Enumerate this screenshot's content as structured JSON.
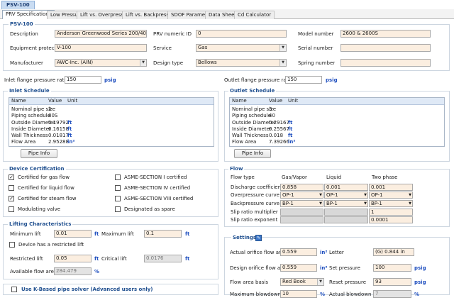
{
  "doc_tab": "PSV-100",
  "tabs": [
    "PRV Specifications",
    "Low Pressure",
    "Lift vs. Overpressure",
    "Lift vs. Backpressure",
    "SDOF Parameters",
    "Data Sheet",
    "Cd Calculator"
  ],
  "psv": {
    "title": "PSV-100",
    "description_label": "Description",
    "description": "Anderson Greenwood Series 200/400/500/700",
    "equipment_label": "Equipment protected",
    "equipment": "V-100",
    "manufacturer_label": "Manufacturer",
    "manufacturer": "AWC-Inc. (AIN)",
    "prv_numeric_label": "PRV numeric ID",
    "prv_numeric": "0",
    "service_label": "Service",
    "service": "Gas",
    "design_label": "Design type",
    "design": "Bellows",
    "model_label": "Model number",
    "model": "2600 & 2600S",
    "serial_label": "Serial number",
    "serial": "",
    "spring_label": "Spring number",
    "spring": ""
  },
  "inlet_flange_label": "Inlet flange pressure rating",
  "inlet_flange": "150",
  "inlet_flange_unit": "psig",
  "outlet_flange_label": "Outlet flange pressure rating",
  "outlet_flange": "150",
  "outlet_flange_unit": "psig",
  "inlet": {
    "title": "Inlet Schedule",
    "headers": [
      "Name",
      "Value",
      "Unit"
    ],
    "rows": [
      {
        "name": "Nominal pipe size",
        "value": "2",
        "unit": ""
      },
      {
        "name": "Piping schedule",
        "value": "80S",
        "unit": ""
      },
      {
        "name": "Outside Diameter",
        "value": "0.19792",
        "unit": "ft"
      },
      {
        "name": "Inside Diameter",
        "value": "0.16158",
        "unit": "ft"
      },
      {
        "name": "Wall Thickness",
        "value": "0.01817",
        "unit": "ft"
      },
      {
        "name": "Flow Area",
        "value": "2.95288",
        "unit": "in²"
      }
    ],
    "button": "Pipe Info"
  },
  "outlet": {
    "title": "Outlet Schedule",
    "headers": [
      "Name",
      "Value",
      "Unit"
    ],
    "rows": [
      {
        "name": "Nominal pipe size",
        "value": "3",
        "unit": ""
      },
      {
        "name": "Piping schedule",
        "value": "40",
        "unit": ""
      },
      {
        "name": "Outside Diameter",
        "value": "0.29167",
        "unit": "ft"
      },
      {
        "name": "Inside Diameter",
        "value": "0.25567",
        "unit": "ft"
      },
      {
        "name": "Wall Thickness",
        "value": "0.018",
        "unit": "ft"
      },
      {
        "name": "Flow Area",
        "value": "7.39266",
        "unit": "in²"
      }
    ],
    "button": "Pipe Info"
  },
  "cert": {
    "title": "Device Certification",
    "items_left": [
      {
        "label": "Certified for gas flow",
        "checked": true
      },
      {
        "label": "Certified for liquid flow",
        "checked": false
      },
      {
        "label": "Certified for steam flow",
        "checked": true
      },
      {
        "label": "Modulating valve",
        "checked": false
      }
    ],
    "items_right": [
      {
        "label": "ASME-SECTION I certified",
        "checked": false
      },
      {
        "label": "ASME-SECTION IV certified",
        "checked": false
      },
      {
        "label": "ASME-SECTION VIII certified",
        "checked": false
      },
      {
        "label": "Designated as spare",
        "checked": false
      }
    ]
  },
  "lift": {
    "title": "Lifting Characteristics",
    "min_label": "Minimum lift",
    "min": "0.01",
    "min_unit": "ft",
    "max_label": "Maximum lift",
    "max": "0.1",
    "max_unit": "ft",
    "restricted_check": "Device has a restricted lift",
    "restricted_label": "Restricted lift",
    "restricted": "0.05",
    "restricted_unit": "ft",
    "critical_label": "Critical lift",
    "critical": "0.0176",
    "critical_unit": "ft",
    "area_label": "Available flow area",
    "area": "284.479",
    "area_unit": "%"
  },
  "kbased": "Use K-Based pipe solver (Advanced users only)",
  "flow": {
    "title": "Flow",
    "col_label": "Flow type",
    "cols": [
      "Gas/Vapor",
      "Liquid",
      "Two phase"
    ],
    "discharge_label": "Discharge coefficient",
    "discharge": [
      "0.858",
      "0.001",
      "0.001"
    ],
    "over_label": "Overpressure curve",
    "over": [
      "OP-1",
      "OP-1",
      "OP-1"
    ],
    "back_label": "Backpressure curve",
    "back": [
      "BP-1",
      "BP-1",
      "BP-1"
    ],
    "slip_mult_label": "Slip ratio multiplier",
    "slip_mult": "1",
    "slip_exp_label": "Slip ratio exponent",
    "slip_exp": "0.0001"
  },
  "settings": {
    "title": "Settings",
    "actual_area_label": "Actual orifice flow area",
    "actual_area": "0.559",
    "actual_area_unit": "in²",
    "letter_label": "Letter",
    "letter": "(G) 0.844 in",
    "design_area_label": "Design orifice flow area",
    "design_area": "0.559",
    "design_area_unit": "in²",
    "set_label": "Set pressure",
    "set": "100",
    "set_unit": "psig",
    "basis_label": "Flow area basis",
    "basis": "Red Book",
    "reset_label": "Reset pressure",
    "reset": "93",
    "reset_unit": "psig",
    "max_blow_label": "Maximum blowdown",
    "max_blow": "10",
    "max_blow_unit": "%",
    "actual_blow_label": "Actual blowdown",
    "actual_blow": "7",
    "actual_blow_unit": "%"
  }
}
